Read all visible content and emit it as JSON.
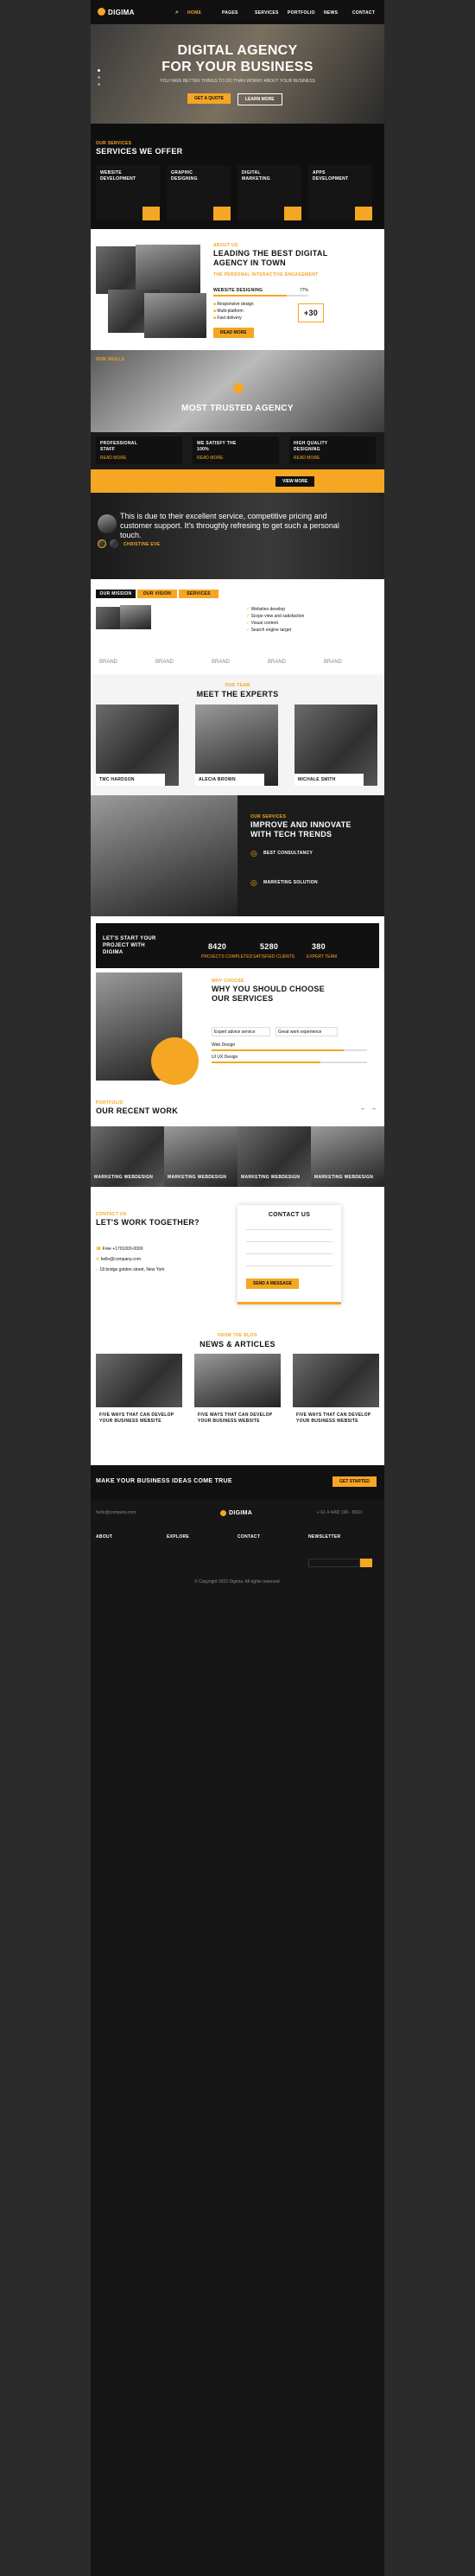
{
  "nav": {
    "brand": "DIGIMA",
    "items": [
      "HOME",
      "PAGES",
      "SERVICES",
      "PORTFOLIO",
      "NEWS",
      "CONTACT"
    ]
  },
  "hero": {
    "title1": "DIGITAL AGENCY",
    "title2": "FOR YOUR BUSINESS",
    "subtitle": "YOU HAVE BETTER THINGS TO DO THAN WORRY ABOUT YOUR BUSINESS",
    "btn1": "GET A QUOTE",
    "btn2": "LEARN MORE"
  },
  "services": {
    "kicker": "OUR SERVICES",
    "title": "SERVICES WE OFFER",
    "items": [
      {
        "title": "WEBSITE DEVELOPMENT"
      },
      {
        "title": "GRAPHIC DESIGNING"
      },
      {
        "title": "DIGITAL MARKETING"
      },
      {
        "title": "APPS DEVELOPMENT"
      }
    ]
  },
  "about": {
    "kicker": "ABOUT US",
    "title": "LEADING THE BEST DIGITAL AGENCY IN TOWN",
    "sub": "THE PERSONAL INTERACTIVE ENGAGEMENT",
    "bar_label": "WEBSITE DESIGNING",
    "bar_value": "77%",
    "bar_level": 0.77,
    "bullets": [
      "Responsive design",
      "Multi-platform",
      "Fast delivery",
      "Client support"
    ],
    "badge_num": "+30",
    "btn": "READ MORE"
  },
  "trusted": {
    "kicker": "OUR SKILLS",
    "title": "MOST TRUSTED AGENCY",
    "cards": [
      {
        "title": "PROFESSIONAL STAFF"
      },
      {
        "title": "WE SATISFY THE 100%"
      },
      {
        "title": "HIGH QUALITY DESIGNING"
      }
    ],
    "card_btn": "READ MORE",
    "promo_btn": "VIEW MORE"
  },
  "testimonial": {
    "quote": "This is due to their excellent service, competitive pricing and customer support. It's throughly refresing to get such a personal touch.",
    "author": "CHRISTINE EVE"
  },
  "tabs": {
    "items": [
      "OUR MISSION",
      "OUR VISION",
      "SERVICES"
    ],
    "checks": [
      "Websites develop",
      "Scope view and satisfaction",
      "Visual content",
      "Search engine target"
    ]
  },
  "brands": [
    "BRAND",
    "BRAND",
    "BRAND",
    "BRAND",
    "BRAND"
  ],
  "team": {
    "kicker": "OUR TEAM",
    "title": "MEET THE EXPERTS",
    "members": [
      {
        "name": "TMC HARDSON"
      },
      {
        "name": "ALECIA BROWN"
      },
      {
        "name": "MICHALE SMITH"
      }
    ]
  },
  "innovate": {
    "kicker": "OUR SERVICES",
    "title": "IMPROVE AND INNOVATE WITH TECH TRENDS",
    "feat1": "BEST CONSULTANCY",
    "feat2": "MARKETING SOLUTION"
  },
  "stats": {
    "title": "LET'S START YOUR PROJECT WITH DIGIMA",
    "items": [
      {
        "value": "8420",
        "label": "PROJECTS COMPLETED"
      },
      {
        "value": "5280",
        "label": "SATISFIED CLIENTS"
      },
      {
        "value": "380",
        "label": "EXPERT TEAM"
      }
    ]
  },
  "why": {
    "kicker": "WHY CHOOSE",
    "title": "WHY YOU SHOULD CHOOSE OUR SERVICES",
    "pill1": "Expert advice service",
    "pill2": "Great work experience",
    "skills": [
      {
        "label": "Web Design",
        "level": 0.85
      },
      {
        "label": "UI UX Design",
        "level": 0.7
      }
    ]
  },
  "work": {
    "kicker": "PORTFOLIO",
    "title": "OUR RECENT WORK",
    "items": [
      "MARKETING WEBDESIGN",
      "MARKETING WEBDESIGN",
      "MARKETING WEBDESIGN",
      "MARKETING WEBDESIGN"
    ]
  },
  "contact": {
    "kicker": "CONTACT US",
    "title": "LET'S WORK TOGETHER?",
    "phone": "Free +1701000-0000",
    "email": "hello@company.com",
    "address": "18 bridge golden street, New York",
    "form_title": "CONTACT US",
    "btn": "SEND A MESSAGE"
  },
  "news": {
    "kicker": "FROM THE BLOG",
    "title": "NEWS & ARTICLES",
    "posts": [
      "FIVE WAYS THAT CAN DEVELOP YOUR BUSINESS WEBSITE",
      "FIVE WAYS THAT CAN DEVELOP YOUR BUSINESS WEBSITE",
      "FIVE WAYS THAT CAN DEVELOP YOUR BUSINESS WEBSITE"
    ]
  },
  "cta": {
    "title": "MAKE YOUR BUSINESS IDEAS COME TRUE",
    "btn": "GET STARTED"
  },
  "footer": {
    "email": "hello@company.com",
    "brand": "DIGIMA",
    "phone": "+ 61 4 4492 196 - 8910",
    "cols": [
      "ABOUT",
      "EXPLORE",
      "CONTACT",
      "NEWSLETTER"
    ],
    "copy": "© Copyright 2023 Digima. All rights reserved."
  }
}
